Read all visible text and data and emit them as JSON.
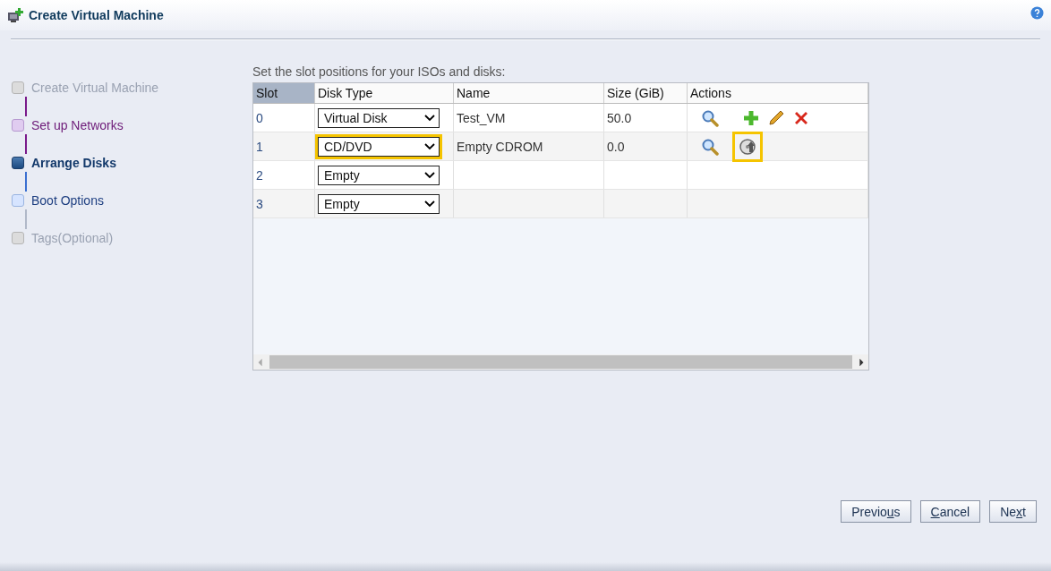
{
  "window": {
    "title": "Create Virtual Machine"
  },
  "steps": [
    {
      "label": "Create Virtual Machine",
      "selected": false,
      "visited": true,
      "disabled": true
    },
    {
      "label": "Set up Networks",
      "selected": false,
      "visited": true,
      "disabled": false
    },
    {
      "label": "Arrange Disks",
      "selected": true,
      "visited": false,
      "disabled": false
    },
    {
      "label": "Boot Options",
      "selected": false,
      "visited": false,
      "disabled": false
    },
    {
      "label": "Tags(Optional)",
      "selected": false,
      "visited": false,
      "disabled": true
    }
  ],
  "instruction": "Set the slot positions for your ISOs and disks:",
  "table": {
    "columns": [
      {
        "label": "Slot",
        "sorted": true
      },
      {
        "label": "Disk Type",
        "sorted": false
      },
      {
        "label": "Name",
        "sorted": false
      },
      {
        "label": "Size (GiB)",
        "sorted": false
      },
      {
        "label": "Actions",
        "sorted": false
      }
    ],
    "rows": [
      {
        "slot": "0",
        "disk_type": "Virtual Disk",
        "type_highlighted": false,
        "name": "Test_VM",
        "size": "50.0",
        "actions": [
          {
            "kind": "search",
            "highlighted": false
          },
          {
            "kind": "add",
            "highlighted": false
          },
          {
            "kind": "edit",
            "highlighted": false
          },
          {
            "kind": "delete",
            "highlighted": false
          }
        ]
      },
      {
        "slot": "1",
        "disk_type": "CD/DVD",
        "type_highlighted": true,
        "name": "Empty CDROM",
        "size": "0.0",
        "actions": [
          {
            "kind": "search",
            "highlighted": false
          },
          {
            "kind": "eject",
            "highlighted": true
          }
        ]
      },
      {
        "slot": "2",
        "disk_type": "Empty",
        "type_highlighted": false
      },
      {
        "slot": "3",
        "disk_type": "Empty",
        "type_highlighted": false
      }
    ]
  },
  "buttons": [
    {
      "before": "Previo",
      "key": "u",
      "after": "s"
    },
    {
      "key": "C",
      "after": "ancel"
    },
    {
      "before": "Ne",
      "key": "x",
      "after": "t"
    }
  ]
}
